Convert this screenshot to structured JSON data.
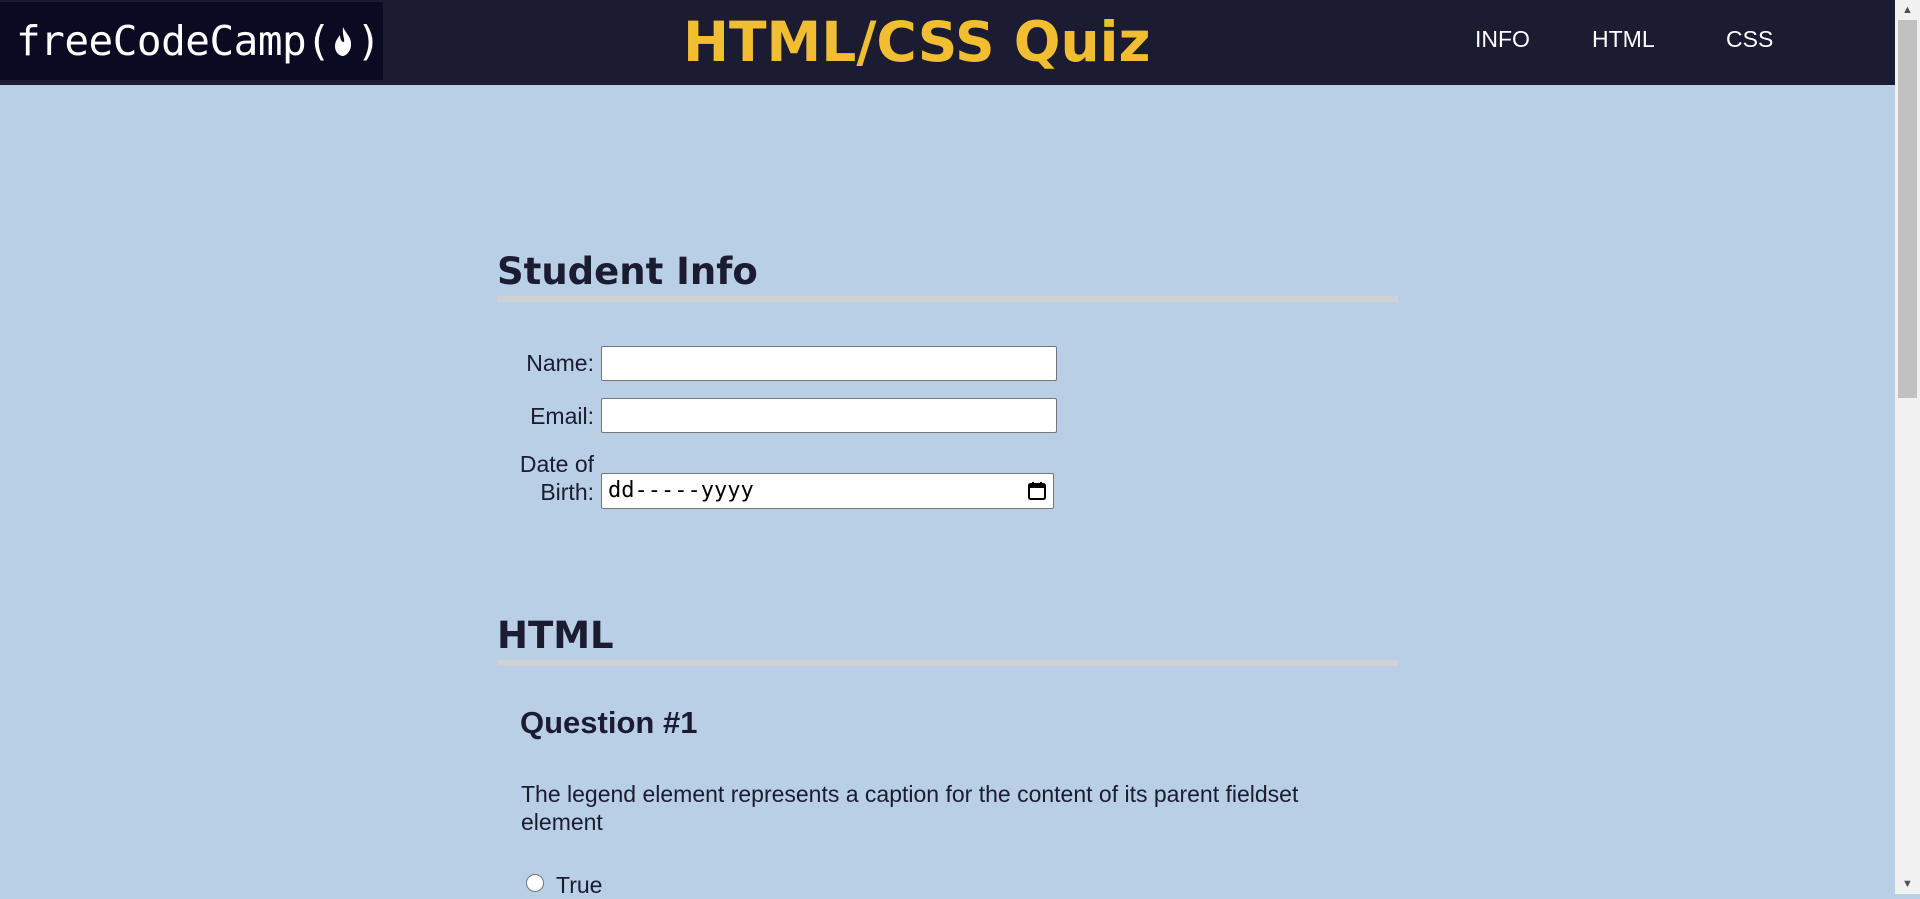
{
  "header": {
    "logo_text": "freeCodeCamp(",
    "logo_text_end": ")",
    "title": "HTML/CSS Quiz",
    "nav": [
      "INFO",
      "HTML",
      "CSS"
    ]
  },
  "student_info": {
    "heading": "Student Info",
    "name_label": "Name:",
    "email_label": "Email:",
    "dob_label_line1": "Date of",
    "dob_label_line2": "Birth:",
    "dob_placeholder": "dd-----yyyy"
  },
  "html_section": {
    "heading": "HTML",
    "question_title": "Question #1",
    "question_text": "The legend element represents a caption for the content of its parent fieldset element",
    "option_true": "True"
  },
  "colors": {
    "background": "#b8cfe5",
    "header_bg": "#1b1b32",
    "logo_bg": "#0a0a23",
    "title": "#f1be32",
    "text": "#1b1b32",
    "heading_rule": "#d0d0d5"
  },
  "icons": [
    "fire-icon",
    "calendar-icon",
    "scroll-up-arrow-icon",
    "scroll-down-arrow-icon"
  ]
}
